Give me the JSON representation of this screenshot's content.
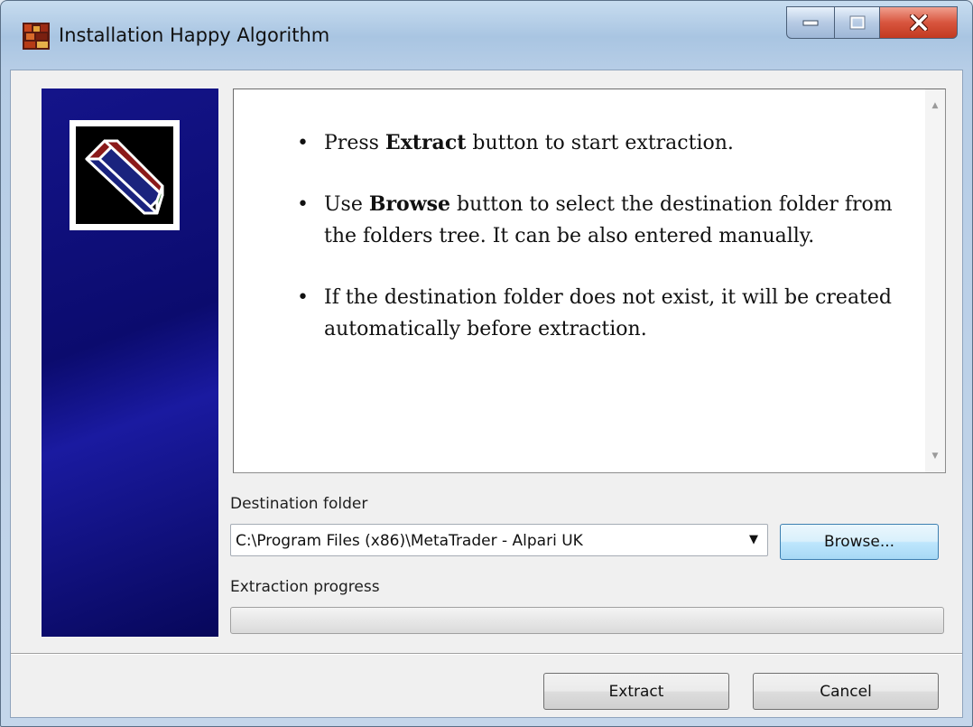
{
  "window": {
    "title": "Installation Happy Algorithm",
    "caption_buttons": [
      "minimize-icon",
      "maximize-icon",
      "close-icon"
    ]
  },
  "info": {
    "items": [
      {
        "prefix": "Press ",
        "bold": "Extract",
        "suffix": " button to start extraction."
      },
      {
        "prefix": "Use ",
        "bold": "Browse",
        "suffix": " button to select the destination folder from the folders tree. It can be also entered manually."
      },
      {
        "prefix": "",
        "bold": "",
        "suffix": "If the destination folder does not exist, it will be created automatically before extraction."
      }
    ]
  },
  "destination": {
    "label": "Destination folder",
    "value": "C:\\Program Files (x86)\\MetaTrader - Alpari UK",
    "browse_label": "Browse..."
  },
  "progress": {
    "label": "Extraction progress",
    "value": 0
  },
  "footer": {
    "extract_label": "Extract",
    "cancel_label": "Cancel"
  },
  "colors": {
    "side_panel": "#0b0b6e",
    "logo_top": "#8b1a1a",
    "logo_front": "#1a237e",
    "logo_side": "#2e7d32",
    "close_button": "#c23a20"
  }
}
